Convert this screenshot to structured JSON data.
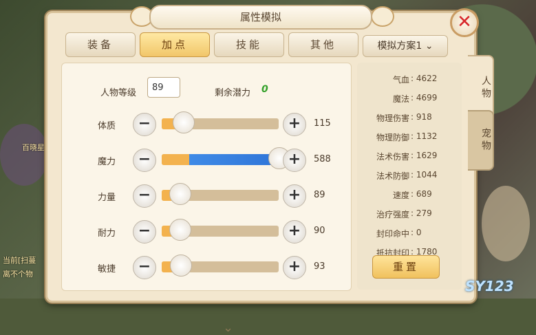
{
  "window": {
    "title": "属性模拟",
    "close_symbol": "✕"
  },
  "tabs": [
    {
      "label": "装备",
      "active": false
    },
    {
      "label": "加点",
      "active": true
    },
    {
      "label": "技能",
      "active": false
    },
    {
      "label": "其他",
      "active": false
    }
  ],
  "level": {
    "label": "人物等级",
    "value": "89"
  },
  "remaining": {
    "label": "剩余潜力",
    "value": "0"
  },
  "attributes": [
    {
      "name": "体质",
      "value": "115",
      "level": 0.18
    },
    {
      "name": "魔力",
      "value": "588",
      "level": 1.0
    },
    {
      "name": "力量",
      "value": "89",
      "level": 0.15
    },
    {
      "name": "耐力",
      "value": "90",
      "level": 0.15
    },
    {
      "name": "敏捷",
      "value": "93",
      "level": 0.16
    }
  ],
  "scheme": {
    "label": "模拟方案1",
    "icon": "chevron-down-icon"
  },
  "stats": [
    {
      "label": "气血",
      "value": "4622"
    },
    {
      "label": "魔法",
      "value": "4699"
    },
    {
      "label": "物理伤害",
      "value": "918"
    },
    {
      "label": "物理防御",
      "value": "1132"
    },
    {
      "label": "法术伤害",
      "value": "1629"
    },
    {
      "label": "法术防御",
      "value": "1044"
    },
    {
      "label": "速度",
      "value": "689"
    },
    {
      "label": "治疗强度",
      "value": "279"
    },
    {
      "label": "封印命中",
      "value": "0"
    },
    {
      "label": "抵抗封印",
      "value": "1780"
    }
  ],
  "reset_label": "重置",
  "side_tabs": [
    {
      "label": "人物",
      "active": true
    },
    {
      "label": "宠物",
      "active": false
    }
  ],
  "watermark": "SY123",
  "background_texts": [
    "百晓星",
    "当前[扫蔓",
    "离不个物"
  ],
  "colors": {
    "panel_bg": "#f3e7cf",
    "active_tab": "#f1c66a",
    "fill_orange": "#f3b24e",
    "fill_blue": "#2f75d8",
    "remain_green": "#34a12a",
    "close_red": "#d7262a"
  }
}
